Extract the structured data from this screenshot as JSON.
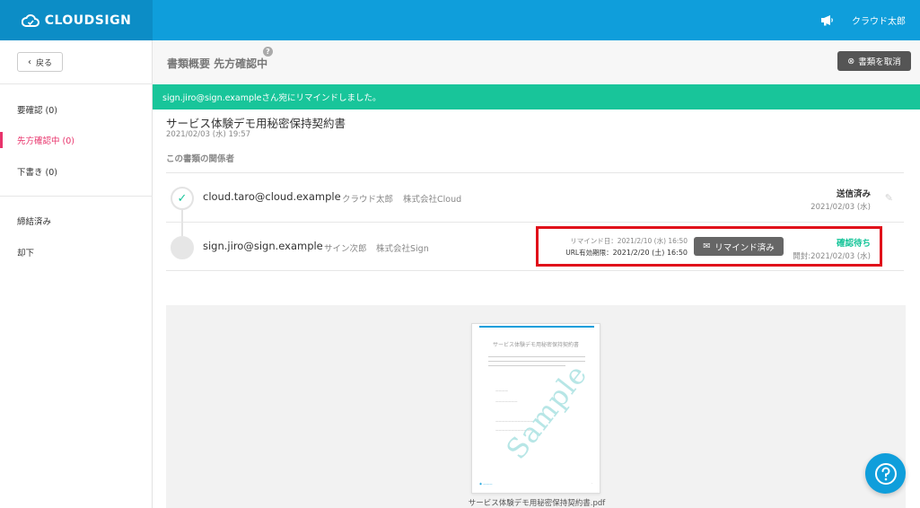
{
  "app": {
    "logo": "CLOUDSIGN"
  },
  "topbar": {
    "user_name": "クラウド太郎"
  },
  "sidebar": {
    "back_label": "戻る",
    "items": [
      {
        "label": "要確認 (0)"
      },
      {
        "label": "先方確認中 (0)"
      },
      {
        "label": "下書き (0)"
      },
      {
        "label": "締結済み"
      },
      {
        "label": "却下"
      }
    ]
  },
  "header": {
    "title": "書類概要 先方確認中",
    "help": "?",
    "cancel_label": "書類を取消"
  },
  "banner": {
    "message": "sign.jiro@sign.exampleさん宛にリマインドしました。"
  },
  "document": {
    "title": "サービス体験デモ用秘密保持契約書",
    "date": "2021/02/03 (水) 19:57",
    "parties_label": "この書類の関係者"
  },
  "parties": [
    {
      "email": "cloud.taro@cloud.example",
      "name": "クラウド太郎",
      "company": "株式会社Cloud",
      "status": "送信済み",
      "status_date": "2021/02/03 (水)"
    },
    {
      "email": "sign.jiro@sign.example",
      "name": "サイン次郎",
      "company": "株式会社Sign",
      "remind_label": "リマインド日：",
      "remind_value": "2021/2/10 (水) 16:50",
      "expiry_label": "URL有効期限：",
      "expiry_value": "2021/2/20 (土) 16:50",
      "remind_button": "リマインド済み",
      "status": "確認待ち",
      "status_date": "開封:2021/02/03 (水)"
    }
  ],
  "preview": {
    "thumb_title": "サービス体験デモ用秘密保持契約書",
    "watermark": "Sample",
    "file_name": "サービス体験デモ用秘密保持契約書.pdf"
  },
  "colors": {
    "brand": "#0f9edb",
    "success": "#18c59a",
    "active": "#e8336b",
    "highlight": "#e0101a"
  }
}
